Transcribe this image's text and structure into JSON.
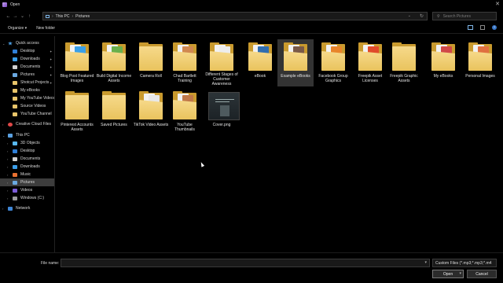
{
  "window": {
    "title": "Open",
    "close_glyph": "✕"
  },
  "nav": {
    "back_glyph": "←",
    "forward_glyph": "→",
    "recent_glyph": "⌄",
    "up_glyph": "↑",
    "breadcrumbs": [
      "This PC",
      "Pictures"
    ],
    "separator": "›",
    "refresh_glyph": "↻",
    "search_placeholder": "Search Pictures"
  },
  "toolbar": {
    "organize_label": "Organize ▾",
    "new_folder_label": "New folder",
    "help_glyph": "?"
  },
  "sidebar": {
    "items": [
      {
        "label": "Quick access",
        "icon": "star-icon",
        "expanded": true
      },
      {
        "label": "Desktop",
        "icon": "desktop-icon",
        "pinned": true
      },
      {
        "label": "Downloads",
        "icon": "downloads-icon",
        "pinned": true
      },
      {
        "label": "Documents",
        "icon": "documents-icon",
        "pinned": true
      },
      {
        "label": "Pictures",
        "icon": "pictures-icon",
        "pinned": true
      },
      {
        "label": "Shotcut Projects",
        "icon": "folder-icon",
        "pinned": true
      },
      {
        "label": "My eBooks",
        "icon": "folder-icon"
      },
      {
        "label": "My YouTube Videos",
        "icon": "folder-icon"
      },
      {
        "label": "Source Videos",
        "icon": "folder-icon"
      },
      {
        "label": "YouTube Channel",
        "icon": "folder-icon"
      },
      {
        "label": "Creative Cloud Files",
        "icon": "creative-cloud-icon"
      },
      {
        "label": "This PC",
        "icon": "pc-icon",
        "expanded": true
      },
      {
        "label": "3D Objects",
        "icon": "3d-objects-icon"
      },
      {
        "label": "Desktop",
        "icon": "desktop-icon"
      },
      {
        "label": "Documents",
        "icon": "documents-icon"
      },
      {
        "label": "Downloads",
        "icon": "downloads-icon"
      },
      {
        "label": "Music",
        "icon": "music-icon"
      },
      {
        "label": "Pictures",
        "icon": "pictures-icon",
        "selected": true
      },
      {
        "label": "Videos",
        "icon": "videos-icon"
      },
      {
        "label": "Windows (C:)",
        "icon": "drive-icon"
      },
      {
        "label": "Network",
        "icon": "network-icon"
      }
    ]
  },
  "files": [
    {
      "label": "Blog Post Featured Images",
      "type": "folder-docs",
      "accent": "#3aa0e8"
    },
    {
      "label": "Build Digital Income Assets",
      "type": "folder-docs",
      "accent": "#6ab04c"
    },
    {
      "label": "Camera Roll",
      "type": "folder"
    },
    {
      "label": "Chad Bartlett Training",
      "type": "folder-docs",
      "accent": "#d08850"
    },
    {
      "label": "Different Stages of Customer Awareness",
      "type": "folder-docs",
      "accent": "#ededed"
    },
    {
      "label": "eBook",
      "type": "folder-docs",
      "accent": "#2f6db0"
    },
    {
      "label": "Example eBooks",
      "type": "folder-docs",
      "accent": "#7a5a48",
      "hover": true
    },
    {
      "label": "Facebook Group Graphics",
      "type": "folder-docs",
      "accent": "#e8842a"
    },
    {
      "label": "Freepik Asset Licenses",
      "type": "folder-docs",
      "accent": "#e04a2a"
    },
    {
      "label": "Freepik Graphic Assets",
      "type": "folder"
    },
    {
      "label": "My eBooks",
      "type": "folder-docs",
      "accent": "#d04848"
    },
    {
      "label": "Personal Images",
      "type": "folder-docs",
      "accent": "#e07040"
    },
    {
      "label": "Pinterest Accounts Assets",
      "type": "folder"
    },
    {
      "label": "Saved Pictures",
      "type": "folder"
    },
    {
      "label": "TikTok Video Assets",
      "type": "folder-docs",
      "accent": "#e8e8e8"
    },
    {
      "label": "YouTube Thumbnails",
      "type": "folder-docs",
      "accent": "#c07848"
    },
    {
      "label": "Cover.png",
      "type": "image"
    }
  ],
  "footer": {
    "file_name_label": "File name:",
    "file_name_value": "",
    "filetype_value": "Custom Files (*.mp3;*.mp3;*.m4",
    "open_label": "Open",
    "cancel_label": "Cancel",
    "dropdown_glyph": "▾"
  }
}
